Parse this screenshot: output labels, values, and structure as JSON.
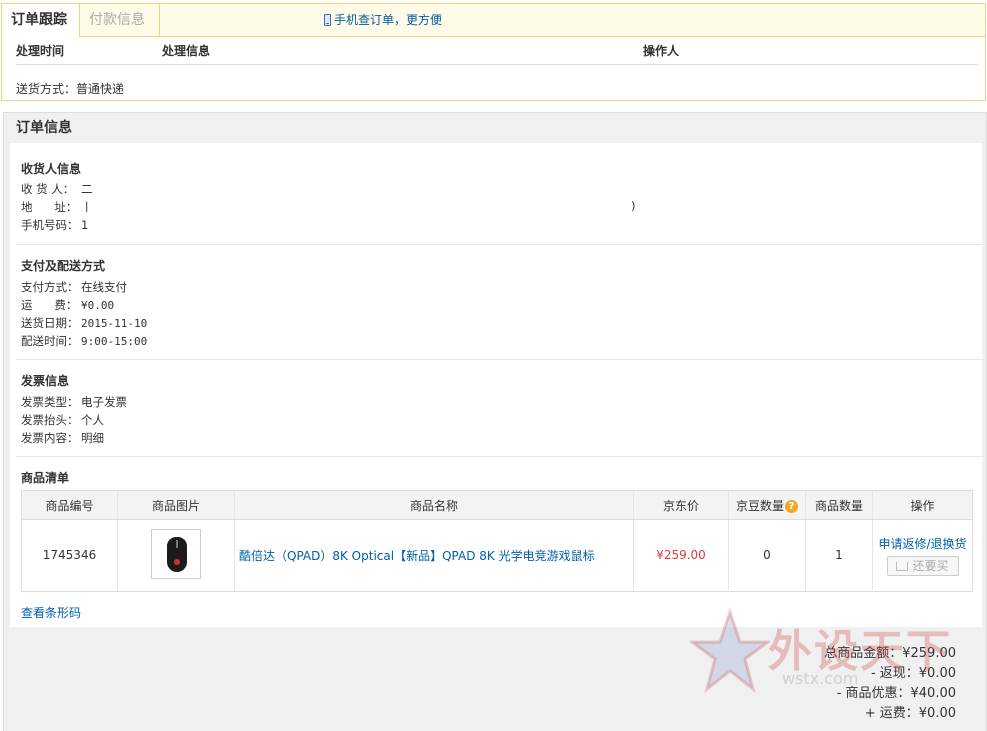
{
  "tracking": {
    "tabs": [
      "订单跟踪",
      "付款信息"
    ],
    "mobile_link": "手机查订单，更方便",
    "columns": [
      "处理时间",
      "处理信息",
      "操作人"
    ],
    "shipping_method": "送货方式：普通快递"
  },
  "order": {
    "title": "订单信息",
    "recipient": {
      "title": "收货人信息",
      "rows": [
        {
          "label": "收 货 人：",
          "value": "⼆"
        },
        {
          "label": "地      址：",
          "value": "⼁"
        },
        {
          "label": "手机号码：",
          "value": "1"
        }
      ],
      "addr_tail": ")"
    },
    "payment": {
      "title": "支付及配送方式",
      "rows": [
        {
          "label": "支付方式：",
          "value": "在线支付"
        },
        {
          "label": "运      费：",
          "value": "¥0.00"
        },
        {
          "label": "送货日期：",
          "value": "2015-11-10"
        },
        {
          "label": "配送时间：",
          "value": "9:00-15:00"
        }
      ]
    },
    "invoice": {
      "title": "发票信息",
      "rows": [
        {
          "label": "发票类型：",
          "value": "电子发票"
        },
        {
          "label": "发票抬头：",
          "value": "个人"
        },
        {
          "label": "发票内容：",
          "value": "明细"
        }
      ]
    },
    "products": {
      "title": "商品清单",
      "headers": [
        "商品编号",
        "商品图片",
        "商品名称",
        "京东价",
        "京豆数量",
        "商品数量",
        "操作"
      ],
      "bean_help_icon": "question-icon",
      "items": [
        {
          "sku": "1745346",
          "name": "酷倍达（QPAD）8K Optical【新品】QPAD 8K 光学电竞游戏鼠标",
          "price": "¥259.00",
          "beans": "0",
          "qty": "1",
          "action": "申请返修/退换货",
          "rebuy": "还要买"
        }
      ],
      "barcode_link": "查看条形码"
    },
    "totals": [
      "总商品金额：¥259.00",
      "- 返现：¥0.00",
      "- 商品优惠：¥40.00",
      "+ 运费：¥0.00"
    ]
  },
  "watermark": {
    "text": "外设天下",
    "url": "wstx.com"
  },
  "colors": {
    "link": "#005ea7",
    "price": "#e4393c",
    "tab_border": "#f1d37e"
  }
}
